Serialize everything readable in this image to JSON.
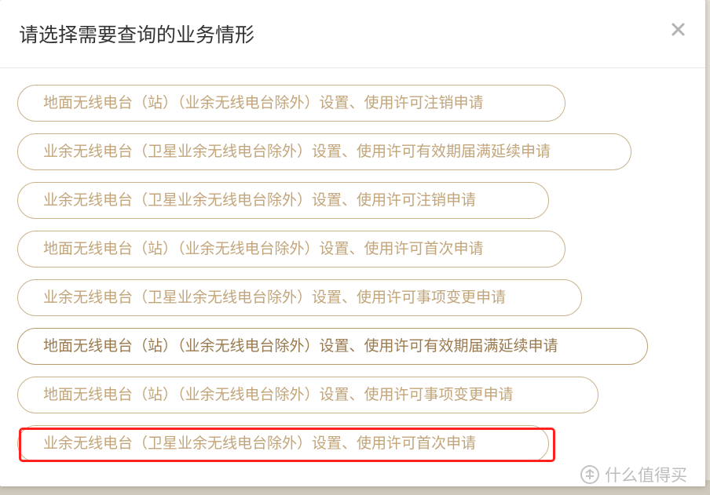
{
  "modal": {
    "title": "请选择需要查询的业务情形",
    "close_label": "×",
    "options": [
      "地面无线电台（站）（业余无线电台除外）设置、使用许可注销申请",
      "业余无线电台（卫星业余无线电台除外）设置、使用许可有效期届满延续申请",
      "业余无线电台（卫星业余无线电台除外）设置、使用许可注销申请",
      "地面无线电台（站）（业余无线电台除外）设置、使用许可首次申请",
      "业余无线电台（卫星业余无线电台除外）设置、使用许可事项变更申请",
      "地面无线电台（站）（业余无线电台除外）设置、使用许可有效期届满延续申请",
      "地面无线电台（站）（业余无线电台除外）设置、使用许可事项变更申请",
      "业余无线电台（卫星业余无线电台除外）设置、使用许可首次申请"
    ]
  },
  "watermark": {
    "text": "什么值得买",
    "icon": "smzdm-logo-icon"
  },
  "colors": {
    "option_text": "#c2a57a",
    "option_border": "#c9b38a",
    "highlight": "#ff2020"
  }
}
